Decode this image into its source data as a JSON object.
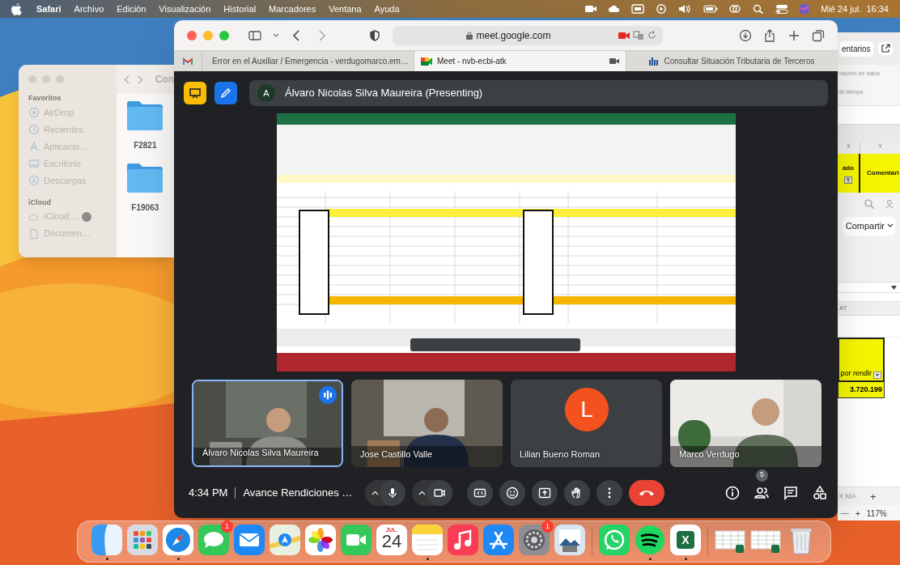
{
  "menu_bar": {
    "app": "Safari",
    "menus": [
      "Archivo",
      "Edición",
      "Visualización",
      "Historial",
      "Marcadores",
      "Ventana",
      "Ayuda"
    ],
    "clock": "Mié 24 jul.  16:34"
  },
  "finder": {
    "path_title": "Con",
    "sidebar": [
      {
        "heading": "Favoritos",
        "items": [
          {
            "label": "AirDrop",
            "kind": "airdrop"
          },
          {
            "label": "Recientes",
            "kind": "recents"
          },
          {
            "label": "Aplicacio…",
            "kind": "apps"
          },
          {
            "label": "Escritorio",
            "kind": "desktop"
          },
          {
            "label": "Descargas",
            "kind": "downloads"
          }
        ]
      },
      {
        "heading": "iCloud",
        "items": [
          {
            "label": "iCloud…",
            "kind": "icloud"
          },
          {
            "label": "Documen…",
            "kind": "document"
          }
        ]
      }
    ],
    "folders": [
      "F2821",
      "F19063"
    ]
  },
  "excel_window": {
    "toolbar_button": "entarios",
    "ribbon_texts": [
      "ntación de datos",
      "de tiempo"
    ],
    "column_headers": [
      "X",
      "Y"
    ],
    "header_cells": [
      "ado",
      "Comentari"
    ],
    "share_button": "Compartir",
    "column_header_2": "AT",
    "total_label": "por rendir",
    "total_value": "3.720.199",
    "sheet_tab": "X MA",
    "add_sheet": "+",
    "zoom_in": "+",
    "zoom_level": "117%"
  },
  "browser": {
    "address": "meet.google.com",
    "tabs": [
      {
        "title": "Error en el Auxiliar / Emergencia - verdugomarco.em…",
        "kind": "mail",
        "selected": false
      },
      {
        "title": "Meet - nvb-ecbi-atk",
        "kind": "meet",
        "selected": true
      },
      {
        "title": "Consultar Situación Tributaria de Terceros",
        "kind": "tax",
        "selected": false
      }
    ]
  },
  "meet": {
    "presenter_initial": "A",
    "presenter_label": "Álvaro Nicolas Silva Maureira (Presenting)",
    "participants": [
      {
        "name": "Álvaro Nicolas Silva Maureira",
        "kind": "video",
        "speaking": true
      },
      {
        "name": "Jose Castillo Valle",
        "kind": "video",
        "speaking": false
      },
      {
        "name": "Lilian Bueno Roman",
        "kind": "avatar",
        "initial": "L",
        "speaking": false
      },
      {
        "name": "Marco Verdugo",
        "kind": "video",
        "speaking": false
      }
    ],
    "time": "4:34 PM",
    "meeting_title": "Avance Rendiciones …",
    "people_count": "5"
  },
  "dock": {
    "sections": [
      {
        "items": [
          {
            "kind": "finder",
            "running": true
          },
          {
            "kind": "launchpad",
            "running": false
          },
          {
            "kind": "safari",
            "running": true
          },
          {
            "kind": "messages",
            "running": false,
            "badge": "1"
          },
          {
            "kind": "mail",
            "running": false
          },
          {
            "kind": "maps",
            "running": false
          },
          {
            "kind": "photos",
            "running": false
          },
          {
            "kind": "facetime",
            "running": false
          },
          {
            "kind": "calendar",
            "running": false,
            "month": "JUL.",
            "day": "24"
          },
          {
            "kind": "notes",
            "running": true
          },
          {
            "kind": "music",
            "running": false
          },
          {
            "kind": "appstore",
            "running": false
          },
          {
            "kind": "settings",
            "running": false,
            "badge": "1"
          },
          {
            "kind": "preview",
            "running": false
          }
        ]
      },
      {
        "items": [
          {
            "kind": "whatsapp",
            "running": false
          },
          {
            "kind": "spotify",
            "running": true
          },
          {
            "kind": "excel",
            "running": true,
            "glyph": "X"
          }
        ]
      },
      {
        "items": [
          {
            "kind": "thumbnail",
            "running": false
          },
          {
            "kind": "thumbnail",
            "running": false
          },
          {
            "kind": "trash",
            "running": false
          }
        ]
      }
    ]
  }
}
